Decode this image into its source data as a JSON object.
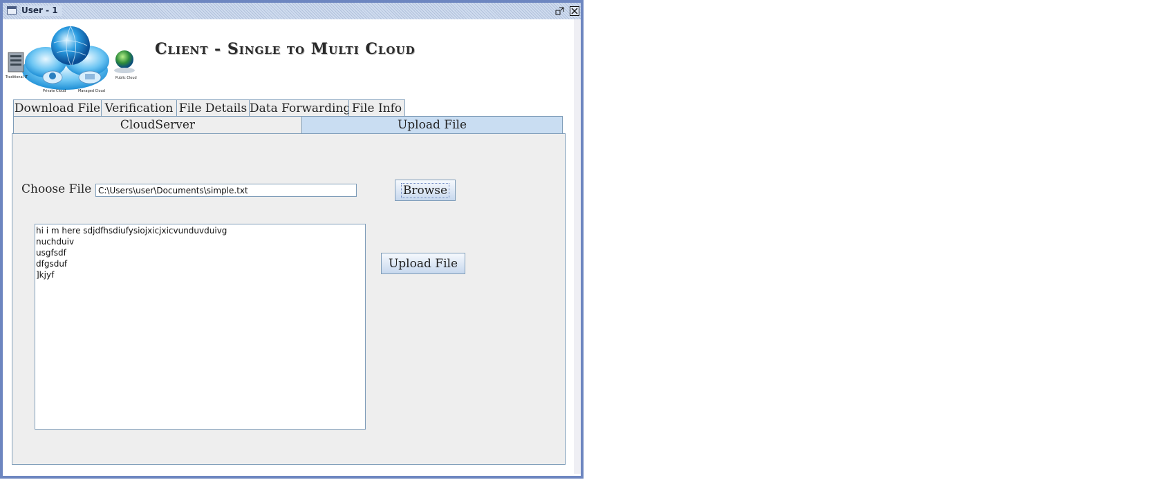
{
  "window": {
    "title": "User - 1",
    "restore_icon": "restore-icon",
    "close_icon": "close-icon"
  },
  "header": {
    "app_title": "Client - Single to Multi Cloud",
    "logo_labels": {
      "traditional": "Traditional IT",
      "private": "Private Cloud",
      "managed": "Managed Cloud",
      "public": "Public Cloud"
    }
  },
  "tabs": {
    "row1": [
      "Download File",
      "Verification",
      "File Details",
      "Data Forwarding",
      "File Info"
    ],
    "row2": [
      "CloudServer",
      "Upload File"
    ],
    "selected": "Upload File"
  },
  "upload": {
    "choose_label": "Choose File",
    "file_path": "C:\\Users\\user\\Documents\\simple.txt",
    "browse_label": "Browse",
    "upload_label": "Upload File",
    "file_content": "hi i m here sdjdfhsdiufysiojxicjxicvunduvduivg\nnuchduiv\nusgfsdf\ndfgsduf\n]kjyf"
  },
  "colors": {
    "window_border": "#6d86c0",
    "selected_tab": "#c9ddf2",
    "panel_bg": "#eeeeee"
  }
}
